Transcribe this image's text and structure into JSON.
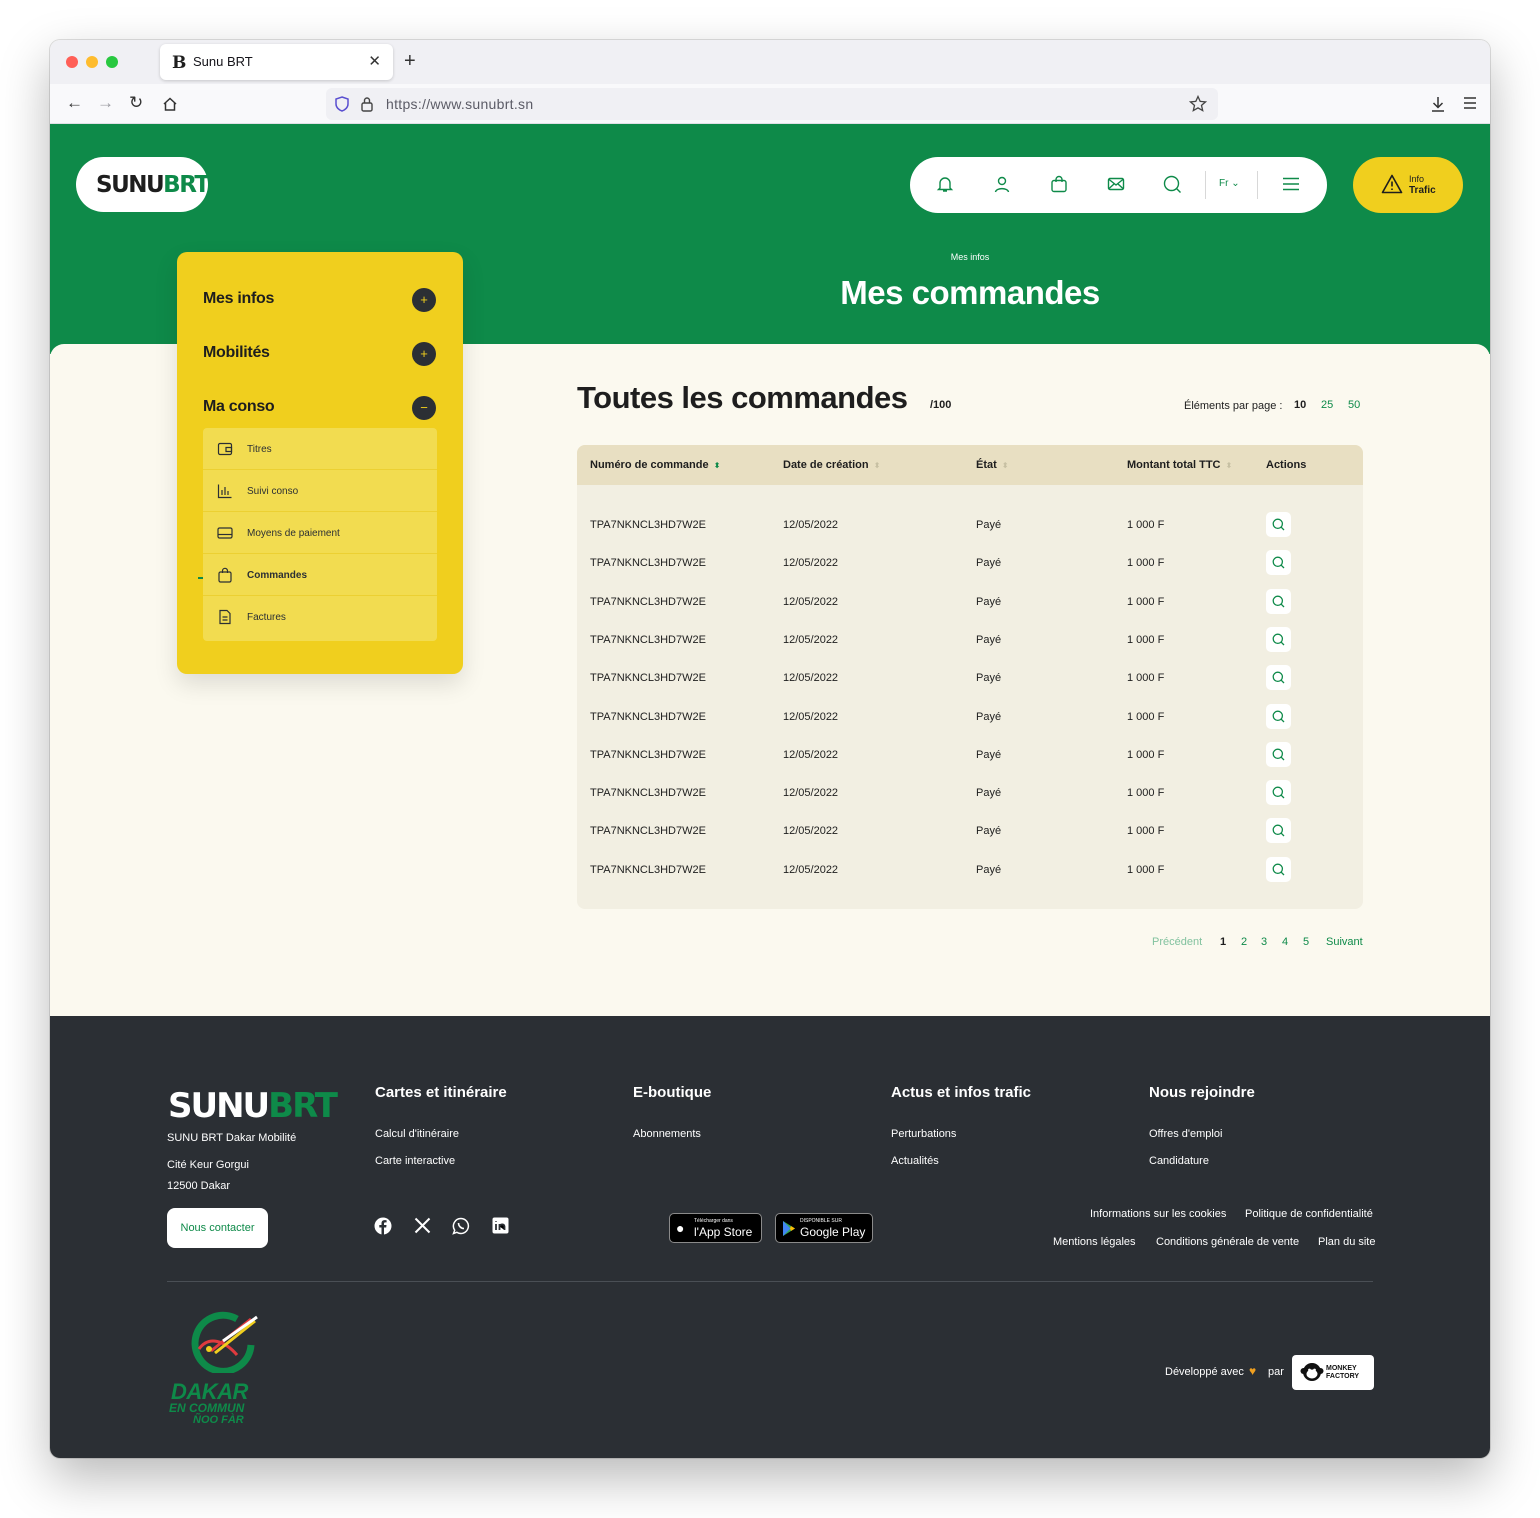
{
  "browser": {
    "tab_title": "Sunu BRT",
    "tab_favicon": "B",
    "url": "https://www.sunubrt.sn"
  },
  "header": {
    "logo": {
      "part1": "SUNU",
      "part2": "BRT"
    },
    "lang": "Fr",
    "info_trafic": {
      "line1": "Info",
      "line2": "Trafic"
    },
    "icons": [
      "bell-icon",
      "user-icon",
      "bag-icon",
      "mail-icon",
      "search-icon",
      "menu-icon"
    ]
  },
  "page": {
    "breadcrumb": "Mes infos",
    "title": "Mes commandes"
  },
  "sidebar": {
    "sections": [
      {
        "label": "Mes infos",
        "toggle": "+"
      },
      {
        "label": "Mobilités",
        "toggle": "+"
      },
      {
        "label": "Ma conso",
        "toggle": "−"
      }
    ],
    "items": [
      {
        "label": "Titres",
        "icon": "wallet-icon"
      },
      {
        "label": "Suivi conso",
        "icon": "chart-icon"
      },
      {
        "label": "Moyens de paiement",
        "icon": "card-icon"
      },
      {
        "label": "Commandes",
        "icon": "bag-icon",
        "active": true
      },
      {
        "label": "Factures",
        "icon": "document-icon"
      }
    ]
  },
  "orders": {
    "title": "Toutes les commandes",
    "count": "/100",
    "per_page_label": "Éléments par page :",
    "per_page_options": [
      "10",
      "25",
      "50"
    ],
    "per_page_selected": "10",
    "columns": [
      "Numéro de commande",
      "Date de création",
      "État",
      "Montant total TTC",
      "Actions"
    ],
    "rows": [
      {
        "number": "TPA7NKNCL3HD7W2E",
        "date": "12/05/2022",
        "state": "Payé",
        "amount": "1 000 F"
      },
      {
        "number": "TPA7NKNCL3HD7W2E",
        "date": "12/05/2022",
        "state": "Payé",
        "amount": "1 000 F"
      },
      {
        "number": "TPA7NKNCL3HD7W2E",
        "date": "12/05/2022",
        "state": "Payé",
        "amount": "1 000 F"
      },
      {
        "number": "TPA7NKNCL3HD7W2E",
        "date": "12/05/2022",
        "state": "Payé",
        "amount": "1 000 F"
      },
      {
        "number": "TPA7NKNCL3HD7W2E",
        "date": "12/05/2022",
        "state": "Payé",
        "amount": "1 000 F"
      },
      {
        "number": "TPA7NKNCL3HD7W2E",
        "date": "12/05/2022",
        "state": "Payé",
        "amount": "1 000 F"
      },
      {
        "number": "TPA7NKNCL3HD7W2E",
        "date": "12/05/2022",
        "state": "Payé",
        "amount": "1 000 F"
      },
      {
        "number": "TPA7NKNCL3HD7W2E",
        "date": "12/05/2022",
        "state": "Payé",
        "amount": "1 000 F"
      },
      {
        "number": "TPA7NKNCL3HD7W2E",
        "date": "12/05/2022",
        "state": "Payé",
        "amount": "1 000 F"
      },
      {
        "number": "TPA7NKNCL3HD7W2E",
        "date": "12/05/2022",
        "state": "Payé",
        "amount": "1 000 F"
      }
    ],
    "pagination": {
      "prev": "Précédent",
      "pages": [
        "1",
        "2",
        "3",
        "4",
        "5"
      ],
      "current": "1",
      "next": "Suivant"
    }
  },
  "footer": {
    "logo": {
      "part1": "SUNU",
      "part2": "BRT"
    },
    "company": "SUNU BRT Dakar Mobilité",
    "address1": "Cité Keur Gorgui",
    "address2": "12500 Dakar",
    "contact_btn": "Nous contacter",
    "columns": [
      {
        "title": "Cartes et itinéraire",
        "links": [
          "Calcul d'itinéraire",
          "Carte interactive"
        ]
      },
      {
        "title": "E-boutique",
        "links": [
          "Abonnements"
        ]
      },
      {
        "title": "Actus et infos trafic",
        "links": [
          "Perturbations",
          "Actualités"
        ]
      },
      {
        "title": "Nous rejoindre",
        "links": [
          "Offres d'emploi",
          "Candidature"
        ]
      }
    ],
    "social": [
      "facebook-icon",
      "x-icon",
      "whatsapp-icon",
      "linkedin-icon"
    ],
    "app_store": {
      "small": "Télécharger dans",
      "big": "l'App Store"
    },
    "google_play": {
      "small": "DISPONIBLE SUR",
      "big": "Google Play"
    },
    "legal_row1": [
      "Informations sur les cookies",
      "Politique de confidentialité"
    ],
    "legal_row2": [
      "Mentions légales",
      "Conditions générale de vente",
      "Plan du site"
    ],
    "dakar": {
      "l1": "DAKAR",
      "l2": "EN COMMUN",
      "l3": "ÑOO FÀR"
    },
    "developed": "Développé avec",
    "par": "par",
    "agency": {
      "l1": "MONKEY",
      "l2": "FACTORY"
    }
  },
  "colors": {
    "brand_green": "#0e8a49",
    "brand_yellow": "#f0cf1e",
    "footer_dark": "#2b2f34"
  }
}
